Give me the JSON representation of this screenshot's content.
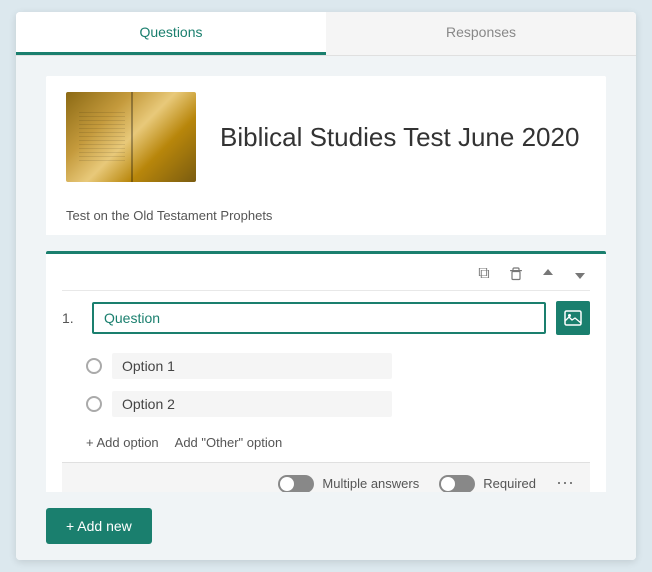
{
  "tabs": [
    {
      "id": "questions",
      "label": "Questions",
      "active": true
    },
    {
      "id": "responses",
      "label": "Responses",
      "active": false
    }
  ],
  "header": {
    "title": "Biblical Studies Test June 2020",
    "subtitle": "Test on the Old Testament Prophets"
  },
  "question_card": {
    "number": "1.",
    "input_value": "Question",
    "toolbar": {
      "copy_icon": "⧉",
      "delete_icon": "🗑",
      "up_icon": "↑",
      "down_icon": "↓"
    },
    "options": [
      {
        "id": "opt1",
        "label": "Option 1"
      },
      {
        "id": "opt2",
        "label": "Option 2"
      }
    ],
    "add_option_label": "+ Add option",
    "add_other_label": "Add \"Other\" option",
    "bottom_bar": {
      "multiple_answers_label": "Multiple answers",
      "required_label": "Required"
    }
  },
  "add_new_button": "+ Add new"
}
